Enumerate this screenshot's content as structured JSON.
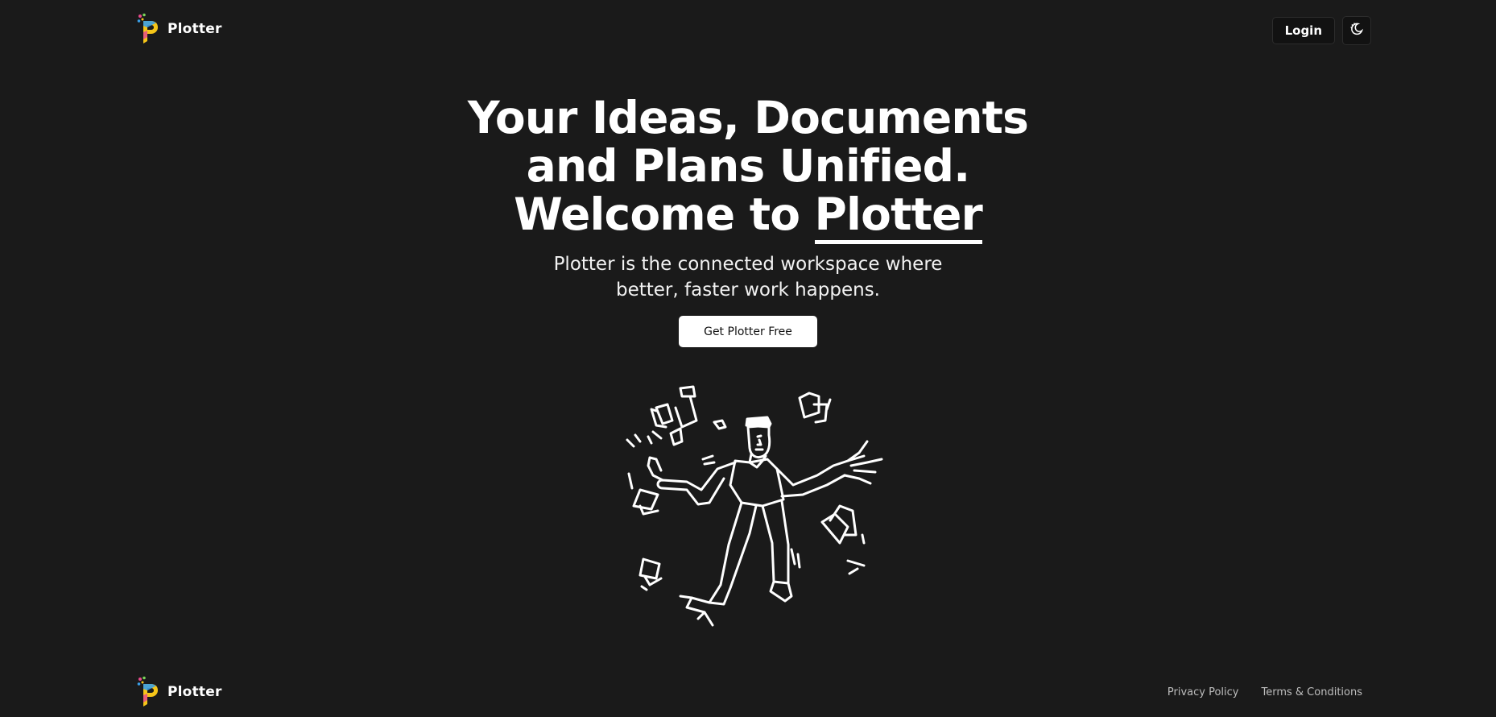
{
  "brand": {
    "name": "Plotter",
    "logo_icon": "plotter-logo-icon",
    "logo_colors": [
      "#f5c518",
      "#e84a8a",
      "#3aa0e8",
      "#7ad35a"
    ]
  },
  "header": {
    "login_label": "Login",
    "theme_toggle_icon": "moon-icon"
  },
  "hero": {
    "headline_line1": "Your Ideas, Documents",
    "headline_line2": "and Plans Unified.",
    "headline_line3_prefix": "Welcome to ",
    "headline_line3_accent": "Plotter",
    "subhead_line1": "Plotter is the connected workspace where",
    "subhead_line2": "better, faster work happens.",
    "cta_label": "Get Plotter Free",
    "illustration_icon": "juggling-documents-illustration"
  },
  "footer": {
    "brand_name": "Plotter",
    "links": [
      "Privacy Policy",
      "Terms & Conditions"
    ]
  },
  "colors": {
    "background": "#1a1a1a",
    "text": "#ffffff",
    "muted": "#bdbdbd",
    "cta_bg": "#ffffff"
  }
}
